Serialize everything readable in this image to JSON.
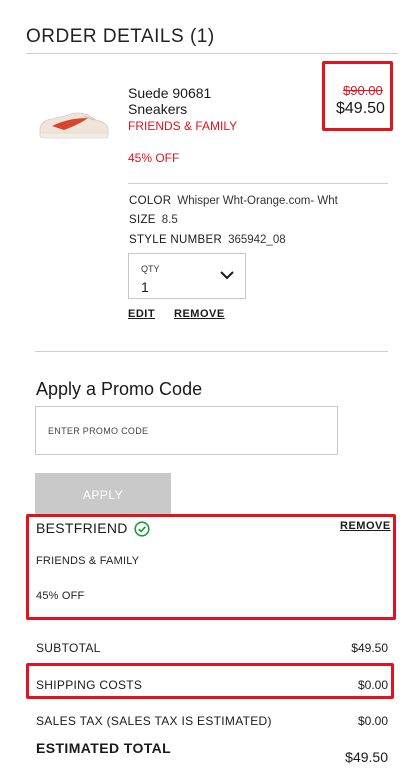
{
  "header": {
    "title": "ORDER DETAILS (1)"
  },
  "item": {
    "name": "Suede 90681 Sneakers",
    "promo_label": "FRIENDS & FAMILY",
    "discount": "45% OFF",
    "original_price": "$90.00",
    "price": "$49.50",
    "image_icon": "sneaker-image",
    "attributes": [
      {
        "key": "COLOR",
        "value": "Whisper Wht-Orange.com- Wht"
      },
      {
        "key": "SIZE",
        "value": "8.5"
      },
      {
        "key": "STYLE NUMBER",
        "value": "365942_08"
      }
    ],
    "quantity": {
      "label": "QTY",
      "value": "1",
      "icon": "chevron-down-icon"
    },
    "edit_label": "EDIT",
    "remove_label": "REMOVE"
  },
  "promo": {
    "heading": "Apply a Promo Code",
    "placeholder": "ENTER PROMO CODE",
    "apply_label": "APPLY",
    "applied": {
      "code": "BESTFRIEND",
      "icon": "check-circle-icon",
      "remove_label": "REMOVE",
      "description": "FRIENDS & FAMILY",
      "discount": "45% OFF"
    }
  },
  "summary": {
    "subtotal_label": "SUBTOTAL",
    "subtotal_value": "$49.50",
    "shipping_label": "SHIPPING COSTS",
    "shipping_value": "$0.00",
    "tax_label": "SALES TAX (SALES TAX IS ESTIMATED)",
    "tax_value": "$0.00",
    "total_label": "ESTIMATED TOTAL",
    "total_value": "$49.50"
  },
  "colors": {
    "accent_red": "#e0131f",
    "success_green": "#1e9c3a",
    "button_disabled": "#c9c9c9"
  }
}
